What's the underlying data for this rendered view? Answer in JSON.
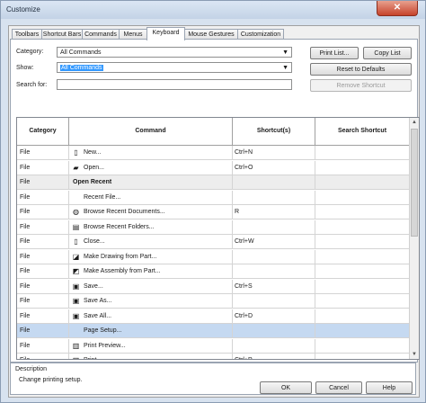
{
  "window": {
    "title": "Customize",
    "close_glyph": "✕"
  },
  "tabs": [
    "Toolbars",
    "Shortcut Bars",
    "Commands",
    "Menus",
    "Keyboard",
    "Mouse Gestures",
    "Customization"
  ],
  "active_tab": "Keyboard",
  "filters": {
    "category_label": "Category:",
    "category_value": "All Commands",
    "show_label": "Show:",
    "show_value": "All Commands",
    "search_label": "Search for:",
    "search_value": ""
  },
  "buttons": {
    "print_list": "Print List...",
    "copy_list": "Copy List",
    "reset_defaults": "Reset to Defaults",
    "remove_shortcut": "Remove Shortcut"
  },
  "table": {
    "headers": [
      "Category",
      "Command",
      "Shortcut(s)",
      "Search Shortcut"
    ],
    "rows": [
      {
        "category": "File",
        "command": "New...",
        "shortcut": "Ctrl+N",
        "search": "",
        "icon": "new-document-icon",
        "glyph": "▯",
        "type": "item"
      },
      {
        "category": "File",
        "command": "Open...",
        "shortcut": "Ctrl+O",
        "search": "",
        "icon": "open-folder-icon",
        "glyph": "▰",
        "type": "item"
      },
      {
        "category": "File",
        "command": "Open Recent",
        "shortcut": "",
        "search": "",
        "icon": "",
        "glyph": "",
        "type": "group"
      },
      {
        "category": "File",
        "command": "Recent File...",
        "shortcut": "",
        "search": "",
        "icon": "",
        "glyph": "",
        "type": "item"
      },
      {
        "category": "File",
        "command": "Browse Recent Documents...",
        "shortcut": "R",
        "search": "",
        "icon": "browse-documents-icon",
        "glyph": "◍",
        "type": "item"
      },
      {
        "category": "File",
        "command": "Browse Recent Folders...",
        "shortcut": "",
        "search": "",
        "icon": "browse-folders-icon",
        "glyph": "▤",
        "type": "item"
      },
      {
        "category": "File",
        "command": "Close...",
        "shortcut": "Ctrl+W",
        "search": "",
        "icon": "close-document-icon",
        "glyph": "▯",
        "type": "item"
      },
      {
        "category": "File",
        "command": "Make Drawing from Part...",
        "shortcut": "",
        "search": "",
        "icon": "make-drawing-icon",
        "glyph": "◪",
        "type": "item"
      },
      {
        "category": "File",
        "command": "Make Assembly from Part...",
        "shortcut": "",
        "search": "",
        "icon": "make-assembly-icon",
        "glyph": "◩",
        "type": "item"
      },
      {
        "category": "File",
        "command": "Save...",
        "shortcut": "Ctrl+S",
        "search": "",
        "icon": "save-icon",
        "glyph": "▣",
        "type": "item"
      },
      {
        "category": "File",
        "command": "Save As...",
        "shortcut": "",
        "search": "",
        "icon": "save-as-icon",
        "glyph": "▣",
        "type": "item"
      },
      {
        "category": "File",
        "command": "Save All...",
        "shortcut": "Ctrl+D",
        "search": "",
        "icon": "save-all-icon",
        "glyph": "▣",
        "type": "item"
      },
      {
        "category": "File",
        "command": "Page Setup...",
        "shortcut": "",
        "search": "",
        "icon": "",
        "glyph": "",
        "type": "selected"
      },
      {
        "category": "File",
        "command": "Print Preview...",
        "shortcut": "",
        "search": "",
        "icon": "print-preview-icon",
        "glyph": "▥",
        "type": "item"
      },
      {
        "category": "File",
        "command": "Print...",
        "shortcut": "Ctrl+P",
        "search": "",
        "icon": "print-icon",
        "glyph": "▥",
        "type": "item"
      }
    ]
  },
  "description": {
    "label": "Description",
    "text": "Change printing setup."
  },
  "footer": {
    "ok": "OK",
    "cancel": "Cancel",
    "help": "Help"
  },
  "colors": {
    "selection": "#c5d9f1",
    "group_row": "#ededed",
    "text_highlight": "#3399ff"
  }
}
